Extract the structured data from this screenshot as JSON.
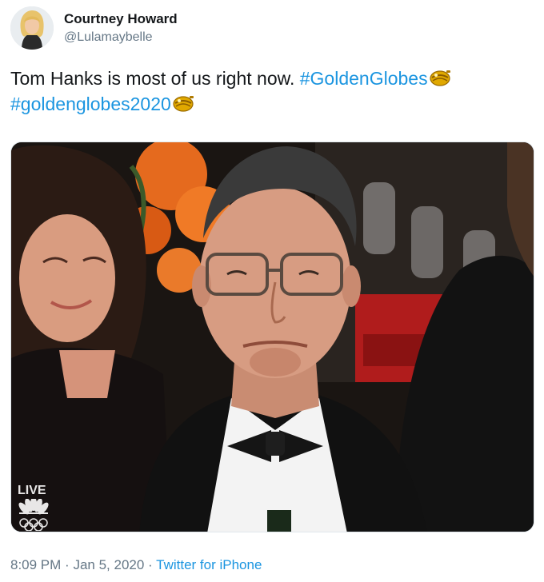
{
  "author": {
    "display_name": "Courtney Howard",
    "handle": "@Lulamaybelle"
  },
  "tweet": {
    "text_plain": "Tom Hanks is most of us right now.",
    "hashtag_1": "#GoldenGlobes",
    "hashtag_2": "#goldenglobes2020",
    "emoji_icon": "golden-globe-emoji-icon"
  },
  "media": {
    "broadcast_badge": "LIVE",
    "network_icon": "nbc-peacock-icon",
    "rings_icon": "olympic-rings-icon"
  },
  "meta": {
    "time": "8:09 PM",
    "separator_1": "·",
    "date": "Jan 5, 2020",
    "separator_2": "·",
    "source_app": "Twitter for iPhone"
  },
  "colors": {
    "link": "#1b95e0",
    "secondary_text": "#657786",
    "primary_text": "#14171a"
  }
}
